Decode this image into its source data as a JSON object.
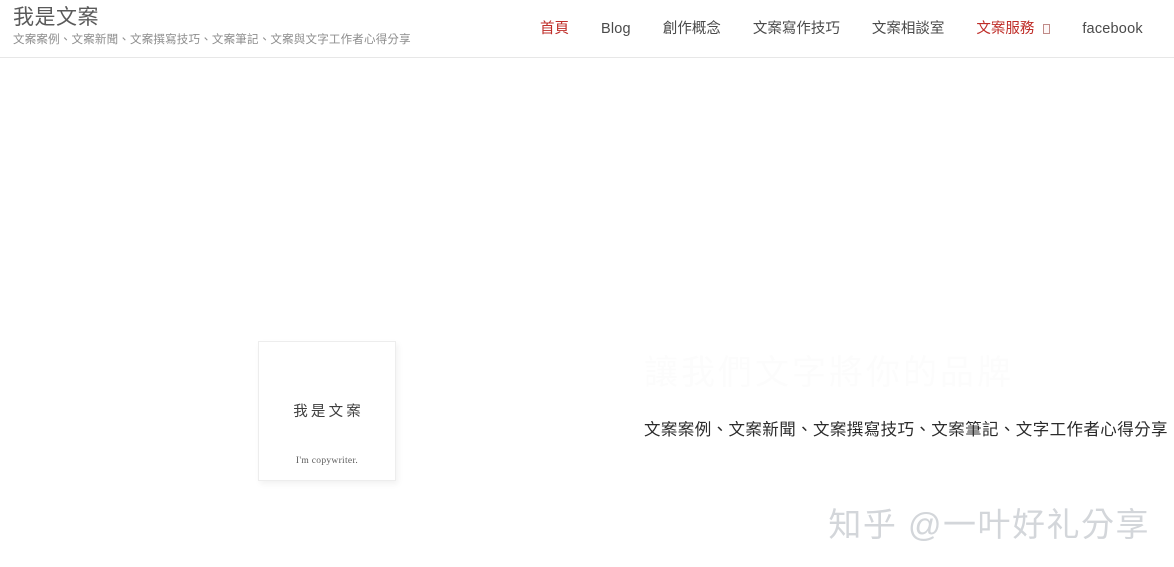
{
  "header": {
    "brand": {
      "title": "我是文案",
      "tagline": "文案案例、文案新聞、文案撰寫技巧、文案筆記、文案與文字工作者心得分享"
    },
    "nav": {
      "items": [
        {
          "label": "首頁",
          "state": "active"
        },
        {
          "label": "Blog",
          "state": "default"
        },
        {
          "label": "創作概念",
          "state": "default"
        },
        {
          "label": "文案寫作技巧",
          "state": "default"
        },
        {
          "label": "文案相談室",
          "state": "default"
        },
        {
          "label": "文案服務",
          "state": "accent",
          "indicator": "missing-glyph-box"
        },
        {
          "label": "facebook",
          "state": "default"
        }
      ]
    }
  },
  "hero": {
    "card": {
      "title": "我是文案",
      "subtitle": "I'm copywriter."
    },
    "headline": "讓我們文字將你的品牌",
    "subline": "文案案例、文案新聞、文案撰寫技巧、文案筆記、文字工作者心得分享"
  },
  "watermark": {
    "text": "知乎 @一叶好礼分享"
  },
  "colors": {
    "accent_red": "#bf2d28",
    "brand_title": "#5a5a5a",
    "brand_tagline": "#8d8d8d",
    "nav_text": "#4a4a4a",
    "header_border": "#e7e7e7",
    "headline_faded": "#fcfcfc",
    "subline_text": "#2b2b2b",
    "watermark_gray": "#d3d6da",
    "page_background": "#ffffff"
  }
}
